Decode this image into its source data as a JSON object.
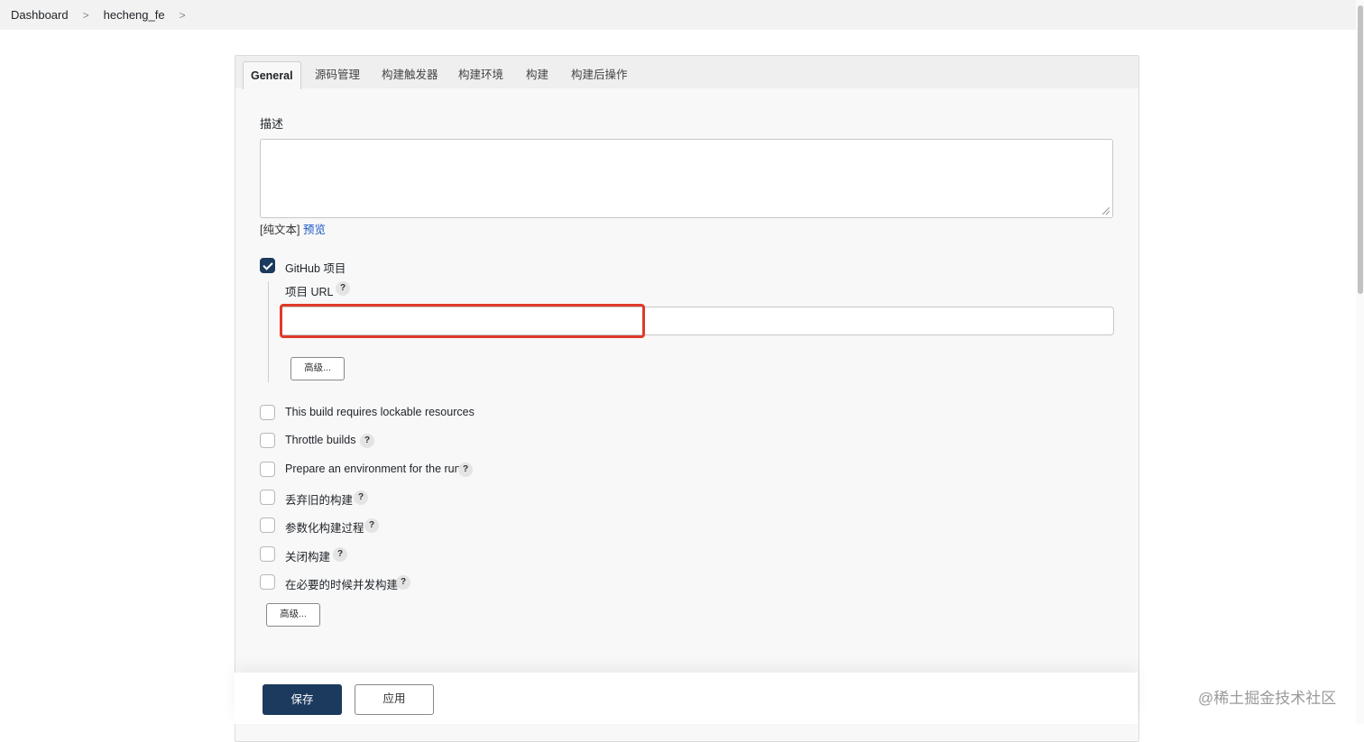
{
  "breadcrumb": {
    "items": [
      "Dashboard",
      "hecheng_fe"
    ],
    "separator": ">"
  },
  "tabs": [
    "General",
    "源码管理",
    "构建触发器",
    "构建环境",
    "构建",
    "构建后操作"
  ],
  "description": {
    "label": "描述",
    "value": "",
    "plain_text": "[纯文本]",
    "preview_link": "预览"
  },
  "github_project": {
    "label": "GitHub 项目",
    "checked": true,
    "url_label": "项目 URL",
    "url_value": "",
    "advanced_button": "高级..."
  },
  "options": [
    {
      "label": "This build requires lockable resources",
      "checked": false,
      "help": false
    },
    {
      "label": "Throttle builds",
      "checked": false,
      "help": true
    },
    {
      "label": "Prepare an environment for the run",
      "checked": false,
      "help": true
    },
    {
      "label": "丢弃旧的构建",
      "checked": false,
      "help": true
    },
    {
      "label": "参数化构建过程",
      "checked": false,
      "help": true
    },
    {
      "label": "关闭构建",
      "checked": false,
      "help": true
    },
    {
      "label": "在必要的时候并发构建",
      "checked": false,
      "help": true
    }
  ],
  "help_glyph": "?",
  "advanced_button": "高级...",
  "footer": {
    "save": "保存",
    "apply": "应用"
  },
  "watermark": "@稀土掘金技术社区",
  "colors": {
    "primary": "#1c3a5e",
    "highlight": "#e03a2a",
    "link": "#1a56c4"
  }
}
